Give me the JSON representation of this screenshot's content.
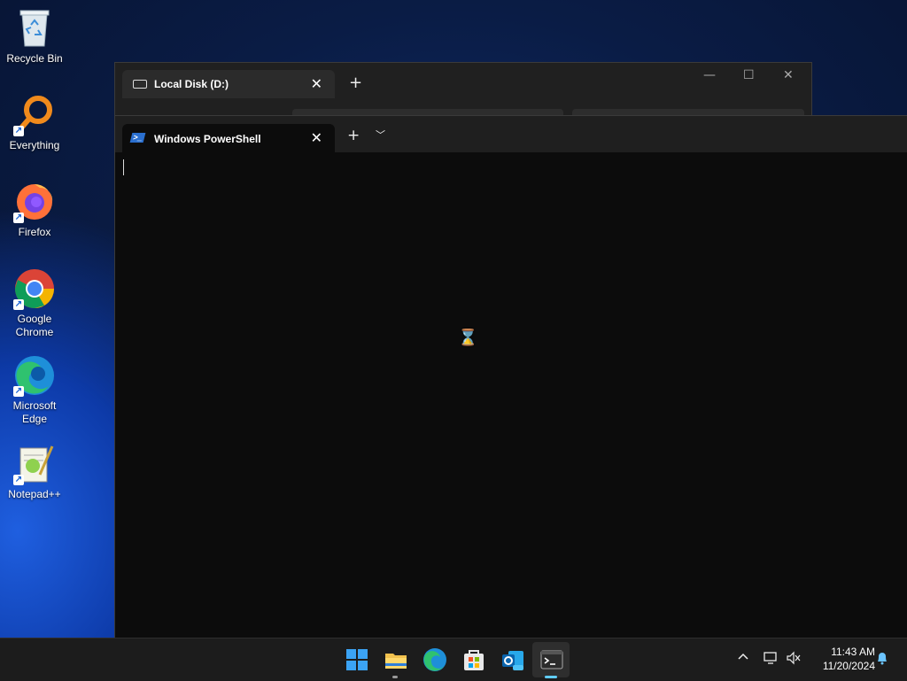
{
  "desktop": {
    "icons": [
      {
        "label": "Recycle Bin"
      },
      {
        "label": "Everything"
      },
      {
        "label": "Firefox"
      },
      {
        "label": "Google Chrome"
      },
      {
        "label": "Microsoft Edge"
      },
      {
        "label": "Notepad++"
      }
    ]
  },
  "explorer": {
    "tab_title": "Local Disk (D:)",
    "new_tab": "+"
  },
  "terminal": {
    "tab_title": "Windows PowerShell",
    "new_tab": "+",
    "dropdown": "⌄",
    "busy_cursor": "⌛"
  },
  "taskbar": {
    "apps": [
      {
        "icon": "start-icon"
      },
      {
        "icon": "file-explorer-icon"
      },
      {
        "icon": "edge-icon"
      },
      {
        "icon": "store-icon"
      },
      {
        "icon": "outlook-new-icon"
      },
      {
        "icon": "terminal-icon",
        "active": true
      }
    ],
    "tray": {
      "chevron": "^",
      "time": "11:43 AM",
      "date": "11/20/2024"
    }
  },
  "colors": {
    "accent": "#60cdff",
    "terminal_bg": "#0c0c0c",
    "taskbar_bg": "#1c1c1c"
  }
}
